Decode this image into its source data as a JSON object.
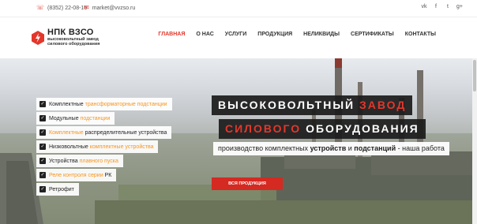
{
  "topbar": {
    "phone": "(8352) 22-08-16",
    "email": "market@vvzso.ru",
    "social": [
      "vk",
      "f",
      "t",
      "g+"
    ]
  },
  "logo": {
    "name": "НПК ВЗСО",
    "subtitle_line1": "высоковольтный завод",
    "subtitle_line2": "силового оборудования"
  },
  "nav": {
    "items": [
      {
        "label": "ГЛАВНАЯ",
        "active": true
      },
      {
        "label": "О НАС"
      },
      {
        "label": "УСЛУГИ"
      },
      {
        "label": "ПРОДУКЦИЯ"
      },
      {
        "label": "НЕЛИКВИДЫ"
      },
      {
        "label": "СЕРТИФИКАТЫ"
      },
      {
        "label": "КОНТАКТЫ"
      }
    ]
  },
  "hero": {
    "checklist": [
      {
        "a": "Комплектные ",
        "b": "трансформаторные подстанции",
        "c": ""
      },
      {
        "a": "Модульные ",
        "b": "подстанции",
        "c": ""
      },
      {
        "a": "",
        "b": "Комплектные",
        "c": " распределительные устройства"
      },
      {
        "a": "Низковольтные ",
        "b": "комплектные устройства",
        "c": ""
      },
      {
        "a": "Устройства ",
        "b": "плавного пуска",
        "c": ""
      },
      {
        "a": "",
        "b": "Реле контроля серии",
        "c": " РК"
      },
      {
        "a": "Ретрофит",
        "b": "",
        "c": ""
      }
    ],
    "headline1_a": "ВЫСОКОВОЛЬТНЫЙ ",
    "headline1_b": "ЗАВОД",
    "headline2_a": "СИЛОВОГО",
    "headline2_b": " ОБОРУДОВАНИЯ",
    "sub_a": "производство комплектных ",
    "sub_b": "устройств",
    "sub_c": " и ",
    "sub_d": "подстанций",
    "sub_e": " - наша работа",
    "cta": "ВСЯ ПРОДУКЦИЯ"
  },
  "colors": {
    "accent": "#e3372c",
    "highlight": "#f7941d",
    "dark": "#1c1c1c"
  }
}
